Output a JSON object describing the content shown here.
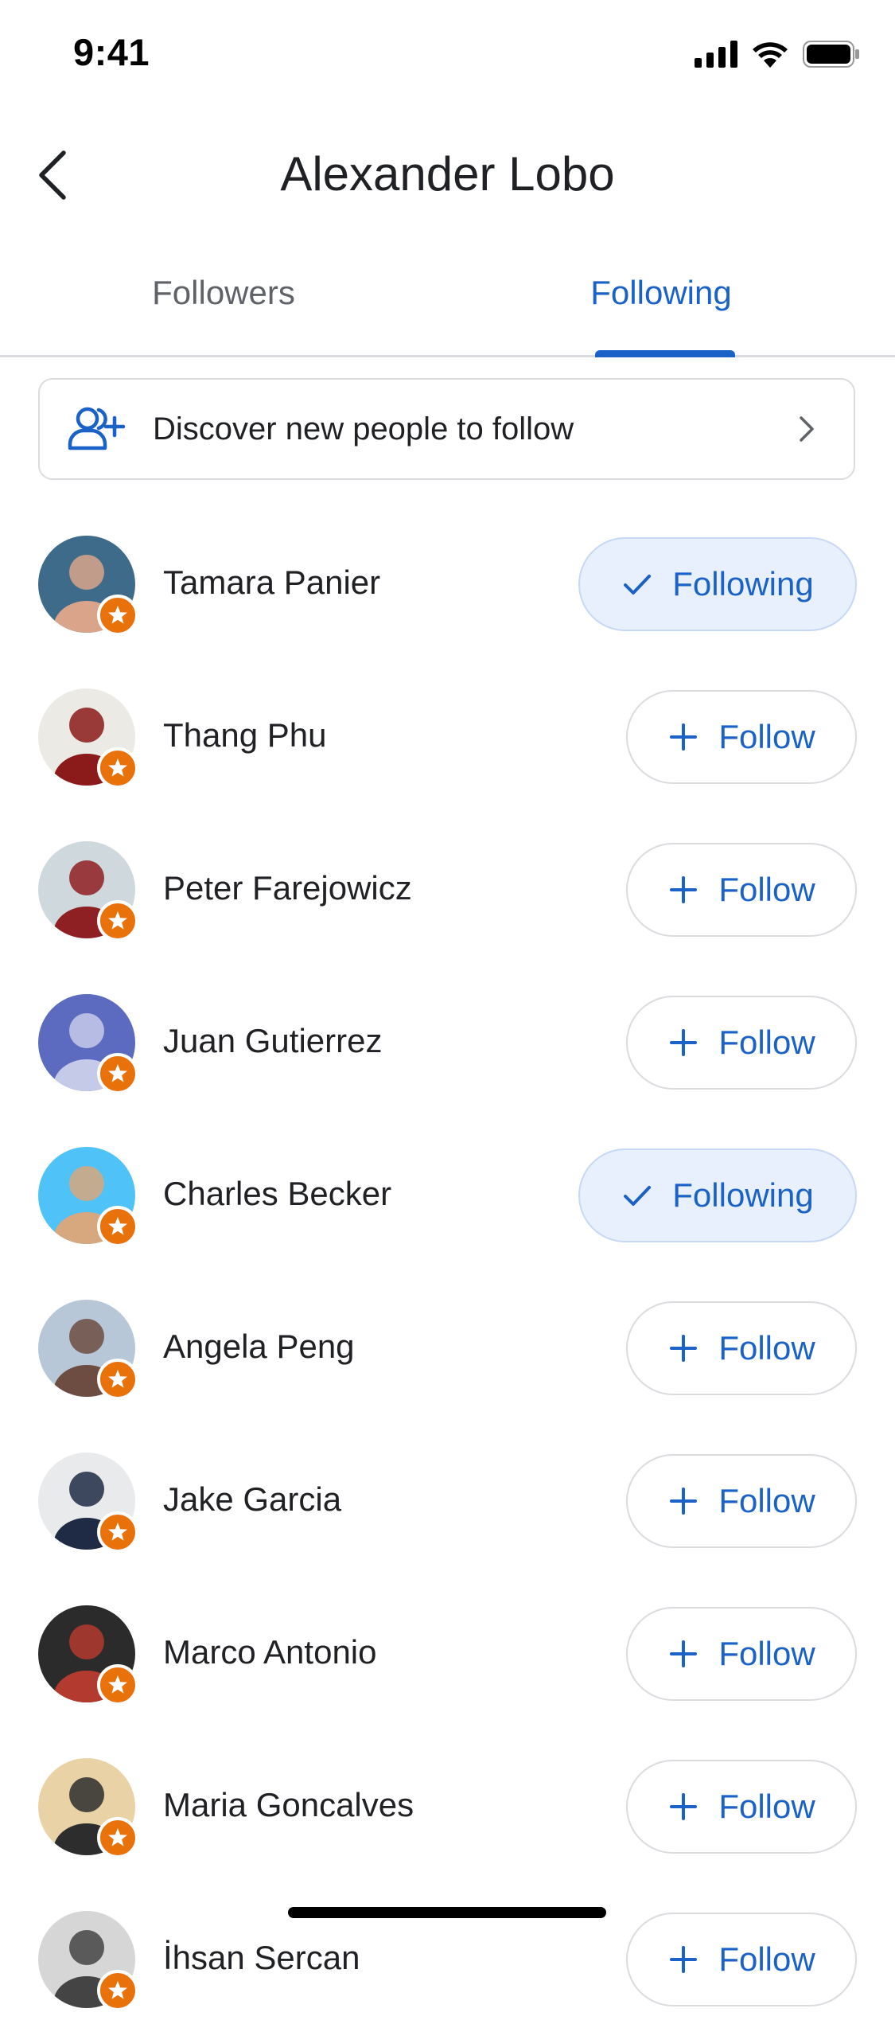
{
  "status_bar": {
    "time": "9:41"
  },
  "header": {
    "title": "Alexander Lobo"
  },
  "tabs": [
    {
      "label": "Followers",
      "active": false
    },
    {
      "label": "Following",
      "active": true
    }
  ],
  "discover": {
    "label": "Discover new people to follow"
  },
  "people": [
    {
      "name": "Tamara Panier",
      "button": "Following",
      "state": "following",
      "avatar_colors": [
        "#3f6b8a",
        "#d9a48a"
      ]
    },
    {
      "name": "Thang Phu",
      "button": "Follow",
      "state": "follow",
      "avatar_colors": [
        "#eceae5",
        "#8b1a1a"
      ]
    },
    {
      "name": "Peter Farejowicz",
      "button": "Follow",
      "state": "follow",
      "avatar_colors": [
        "#cfd8dc",
        "#8e1f22"
      ]
    },
    {
      "name": "Juan Gutierrez",
      "button": "Follow",
      "state": "follow",
      "avatar_colors": [
        "#5c6bc0",
        "#c5cae9"
      ]
    },
    {
      "name": "Charles Becker",
      "button": "Following",
      "state": "following",
      "avatar_colors": [
        "#4fc3f7",
        "#d7a77e"
      ]
    },
    {
      "name": "Angela Peng",
      "button": "Follow",
      "state": "follow",
      "avatar_colors": [
        "#b7c7d8",
        "#6d4c41"
      ]
    },
    {
      "name": "Jake Garcia",
      "button": "Follow",
      "state": "follow",
      "avatar_colors": [
        "#e9eaec",
        "#1f2a44"
      ]
    },
    {
      "name": "Marco Antonio",
      "button": "Follow",
      "state": "follow",
      "avatar_colors": [
        "#2b2b2b",
        "#b33a2e"
      ]
    },
    {
      "name": "Maria Goncalves",
      "button": "Follow",
      "state": "follow",
      "avatar_colors": [
        "#e9d3a6",
        "#2d2d2d"
      ]
    },
    {
      "name": "İhsan Sercan",
      "button": "Follow",
      "state": "follow",
      "avatar_colors": [
        "#d6d6d6",
        "#444444"
      ]
    }
  ],
  "colors": {
    "accent": "#1a62c7",
    "badge": "#e8710a",
    "following_bg": "#e8f0fd"
  }
}
